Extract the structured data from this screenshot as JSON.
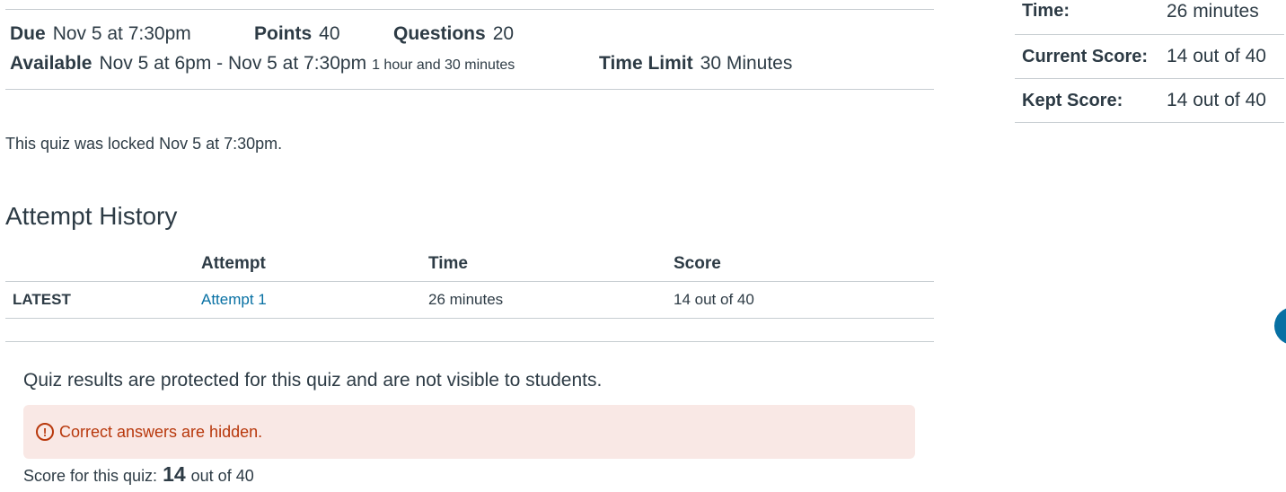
{
  "details": {
    "due_label": "Due",
    "due_value": "Nov 5 at 7:30pm",
    "points_label": "Points",
    "points_value": "40",
    "questions_label": "Questions",
    "questions_value": "20",
    "available_label": "Available",
    "available_value": "Nov 5 at 6pm - Nov 5 at 7:30pm",
    "available_duration": "1 hour and 30 minutes",
    "time_limit_label": "Time Limit",
    "time_limit_value": "30 Minutes"
  },
  "locked_message": "This quiz was locked Nov 5 at 7:30pm.",
  "attempt_history": {
    "heading": "Attempt History",
    "columns": [
      "",
      "Attempt",
      "Time",
      "Score"
    ],
    "rows": [
      {
        "tag": "LATEST",
        "attempt": "Attempt 1",
        "time": "26 minutes",
        "score": "14 out of 40"
      }
    ]
  },
  "results": {
    "protected_message": "Quiz results are protected for this quiz and are not visible to students.",
    "alert_icon": "!",
    "alert_text": "Correct answers are hidden.",
    "score_prefix": "Score for this quiz:",
    "score_value": "14",
    "score_suffix": "out of 40"
  },
  "sidebar": {
    "rows": [
      {
        "label": "Time:",
        "value": "26 minutes"
      },
      {
        "label": "Current Score:",
        "value": "14 out of 40"
      },
      {
        "label": "Kept Score:",
        "value": "14 out of 40"
      }
    ]
  },
  "colors": {
    "text": "#2d3b45",
    "link": "#0770a3",
    "alert_bg": "#f9e8e5",
    "alert_text": "#b8380c",
    "border": "#c7cdd1"
  },
  "icons": {
    "alert": "warning-circle-icon",
    "fab": "help-fab-icon"
  }
}
